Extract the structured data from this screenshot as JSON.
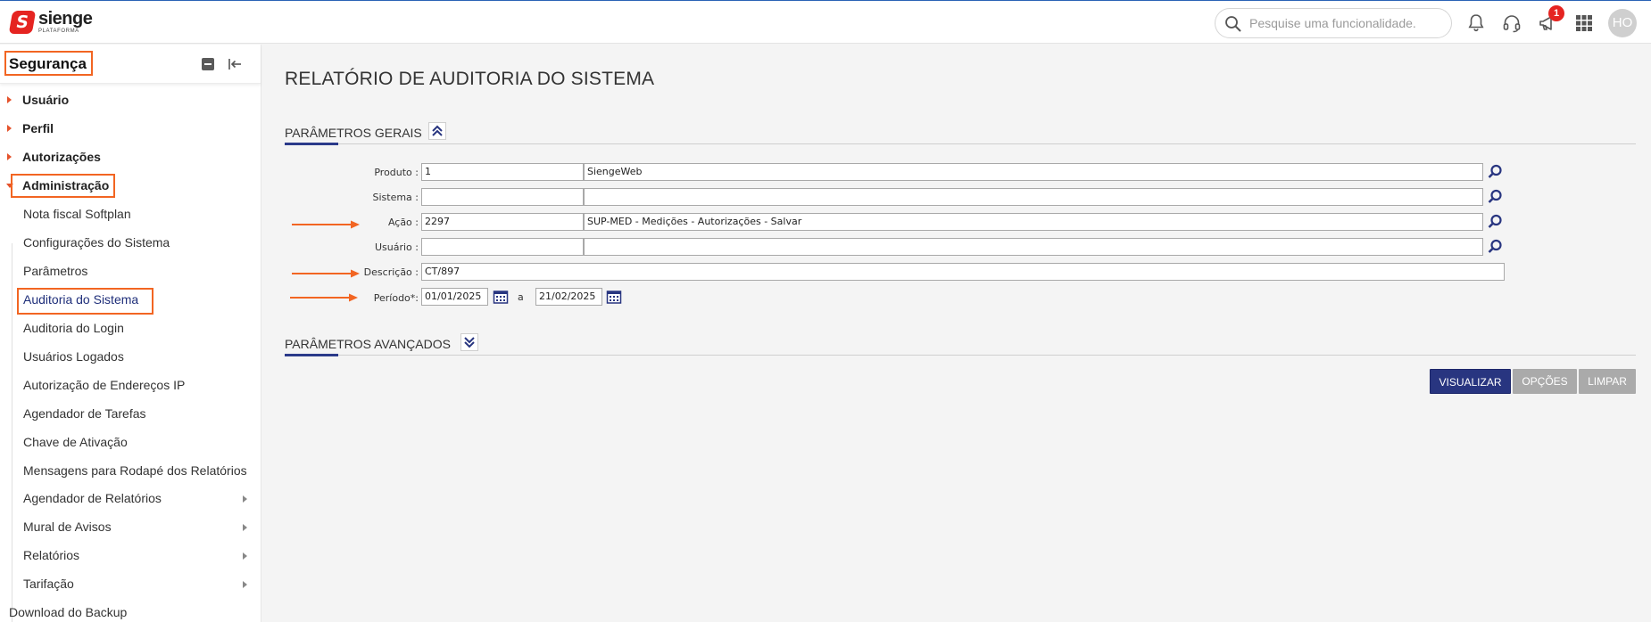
{
  "header": {
    "brand": "sienge",
    "brand_sub": "PLATAFORMA",
    "search_placeholder": "Pesquise uma funcionalidade.",
    "notification_count": "1",
    "avatar_initials": "HO",
    "icons": [
      "search-icon",
      "bell-icon",
      "headset-icon",
      "megaphone-icon",
      "apps-grid-icon"
    ]
  },
  "sidebar": {
    "title": "Segurança",
    "top_items": [
      {
        "label": "Usuário"
      },
      {
        "label": "Perfil"
      },
      {
        "label": "Autorizações"
      },
      {
        "label": "Administração",
        "expanded": true
      }
    ],
    "sub_items": [
      {
        "label": "Nota fiscal Softplan"
      },
      {
        "label": "Configurações do Sistema"
      },
      {
        "label": "Parâmetros"
      },
      {
        "label": "Auditoria do Sistema",
        "selected": true
      },
      {
        "label": "Auditoria do Login"
      },
      {
        "label": "Usuários Logados"
      },
      {
        "label": "Autorização de Endereços IP"
      },
      {
        "label": "Agendador de Tarefas"
      },
      {
        "label": "Chave de Ativação"
      },
      {
        "label": "Mensagens para Rodapé dos Relatórios"
      },
      {
        "label": "Agendador de Relatórios",
        "has_children": true
      },
      {
        "label": "Mural de Avisos",
        "has_children": true
      },
      {
        "label": "Relatórios",
        "has_children": true
      },
      {
        "label": "Tarifação",
        "has_children": true
      }
    ],
    "bottom_item": "Download do Backup"
  },
  "main": {
    "title": "RELATÓRIO DE AUDITORIA DO SISTEMA",
    "section_general": "PARÂMETROS GERAIS",
    "section_advanced": "PARÂMETROS AVANÇADOS",
    "fields": {
      "produto": {
        "label": "Produto :",
        "code": "1",
        "name": "SiengeWeb"
      },
      "sistema": {
        "label": "Sistema :",
        "code": "",
        "name": ""
      },
      "acao": {
        "label": "Ação :",
        "code": "2297",
        "name": "SUP-MED - Medições - Autorizações - Salvar"
      },
      "usuario": {
        "label": "Usuário :",
        "code": "",
        "name": ""
      },
      "descricao": {
        "label": "Descrição :",
        "value": "CT/897"
      },
      "periodo": {
        "label": "Período*:",
        "start": "01/01/2025",
        "separator": "a",
        "end": "21/02/2025"
      }
    },
    "buttons": {
      "visualizar": "VISUALIZAR",
      "opcoes": "OPÇÕES",
      "limpar": "LIMPAR"
    }
  },
  "colors": {
    "accent": "#283580",
    "highlight": "#f26522",
    "brand": "#e52421"
  }
}
